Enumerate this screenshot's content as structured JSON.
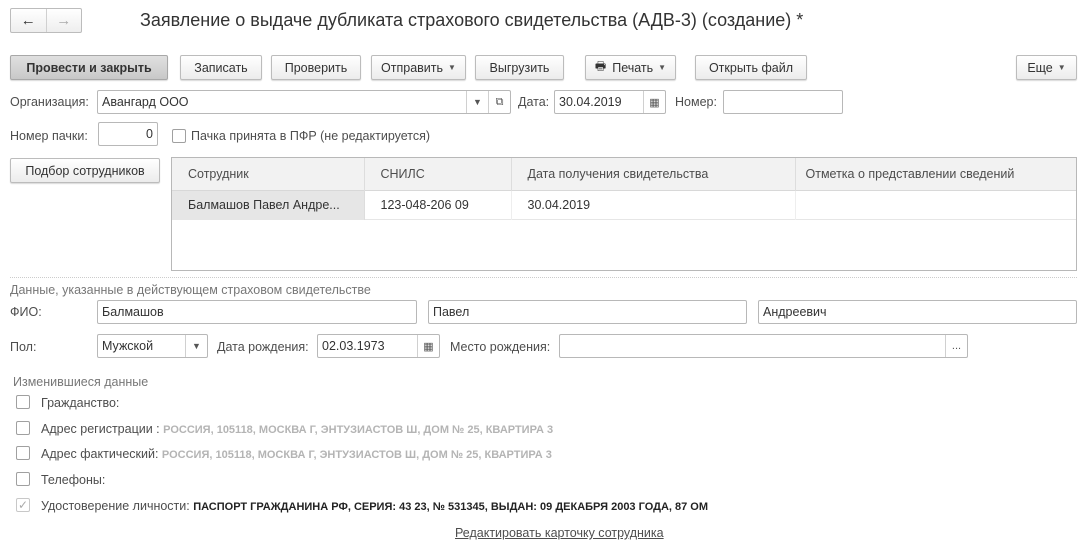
{
  "nav": {
    "back": "←",
    "forward": "→"
  },
  "title": "Заявление о выдаче дубликата страхового свидетельства (АДВ-3) (создание) *",
  "toolbar": {
    "post_close": "Провести и закрыть",
    "save": "Записать",
    "check": "Проверить",
    "send": "Отправить",
    "export": "Выгрузить",
    "print": "Печать",
    "open_file": "Открыть файл",
    "more": "Еще"
  },
  "form": {
    "org_label": "Организация:",
    "org_value": "Авангард ООО",
    "date_label": "Дата:",
    "date_value": "30.04.2019",
    "number_label": "Номер:",
    "number_value": "",
    "pack_label": "Номер пачки:",
    "pack_value": "0",
    "pfr_accepted_label": "Пачка принята в ПФР (не редактируется)"
  },
  "pick_employees": "Подбор сотрудников",
  "table": {
    "columns": [
      "Сотрудник",
      "СНИЛС",
      "Дата получения свидетельства",
      "Отметка о представлении сведений"
    ],
    "rows": [
      [
        "Балмашов Павел Андре...",
        "123-048-206 09",
        "30.04.2019",
        ""
      ]
    ]
  },
  "section": {
    "title": "Данные, указанные в действующем страховом свидетельстве",
    "fio_label": "ФИО:",
    "last_name": "Балмашов",
    "first_name": "Павел",
    "middle_name": "Андреевич",
    "sex_label": "Пол:",
    "sex_value": "Мужской",
    "birth_label": "Дата рождения:",
    "birth_value": "02.03.1973",
    "birthplace_label": "Место рождения:",
    "birthplace_value": "",
    "ellipsis": "..."
  },
  "changed": {
    "title": "Изменившиеся данные",
    "items": [
      {
        "label": "Гражданство:",
        "value": "",
        "checked": false
      },
      {
        "label": "Адрес регистрации :",
        "value": "РОССИЯ, 105118, МОСКВА Г, ЭНТУЗИАСТОВ Ш, ДОМ № 25, КВАРТИРА 3",
        "checked": false
      },
      {
        "label": "Адрес фактический:",
        "value": "РОССИЯ, 105118, МОСКВА Г, ЭНТУЗИАСТОВ Ш, ДОМ № 25, КВАРТИРА 3",
        "checked": false
      },
      {
        "label": "Телефоны:",
        "value": "",
        "checked": false
      },
      {
        "label": "Удостоверение личности:",
        "value": "ПАСПОРТ ГРАЖДАНИНА РФ, СЕРИЯ: 43 23, № 531345, ВЫДАН: 09 ДЕКАБРЯ 2003 ГОДА, 87 ОМ",
        "checked": true
      }
    ]
  },
  "edit_link": "Редактировать карточку сотрудника"
}
